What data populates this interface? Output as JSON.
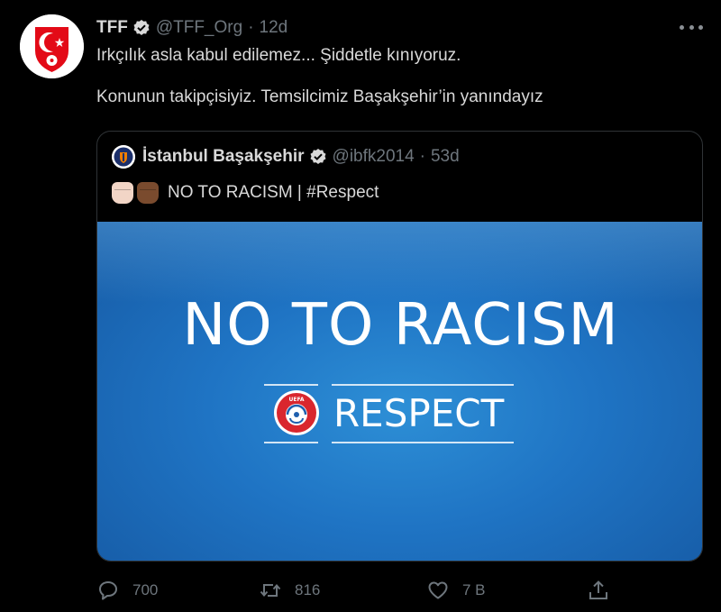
{
  "tweet": {
    "author_name": "TFF",
    "handle": "@TFF_Org",
    "separator": "·",
    "time": "12d",
    "paragraphs": [
      "Irkçılık asla kabul edilemez... Şiddetle kınıyoruz.",
      "Konunun takipçisiyiz. Temsilcimiz Başakşehir’in yanındayız"
    ]
  },
  "quoted": {
    "author_name": "İstanbul Başakşehir",
    "handle": "@ibfk2014",
    "separator": "·",
    "time": "53d",
    "text": "NO TO RACISM | #Respect",
    "media": {
      "title": "NO TO RACISM",
      "badge_text": "UEFA",
      "subtitle": "RESPECT"
    }
  },
  "actions": {
    "reply_count": "700",
    "retweet_count": "816",
    "like_count": "7 B"
  },
  "icons": {
    "avatar": "tff-crest-icon",
    "verified": "verified-badge-icon",
    "more": "more-options-icon",
    "reply": "reply-icon",
    "retweet": "retweet-icon",
    "like": "like-icon",
    "share": "share-icon"
  },
  "colors": {
    "background": "#000000",
    "text": "#d9d9d9",
    "muted": "#6e767d",
    "border": "#2f3336",
    "brand_red": "#e30a17",
    "media_blue": "#1f74c4"
  }
}
